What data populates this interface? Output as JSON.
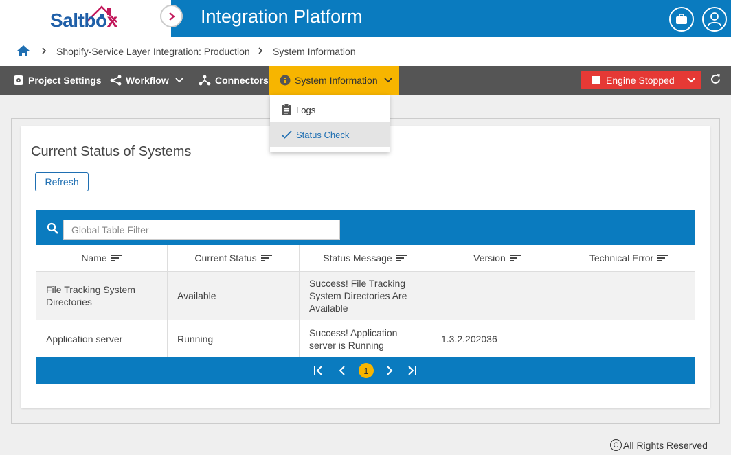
{
  "header": {
    "logo_text_main": "Saltbo",
    "logo_text_x": "x",
    "title": "Integration Platform"
  },
  "breadcrumb": {
    "project": "Shopify-Service Layer Integration: Production",
    "current": "System Information"
  },
  "toolbar": {
    "project_settings": "Project Settings",
    "workflow": "Workflow",
    "connectors": "Connectors",
    "system_information": "System Information",
    "engine_status": "Engine Stopped"
  },
  "dropdown": {
    "items": [
      {
        "label": "Logs",
        "icon": "clipboard-icon"
      },
      {
        "label": "Status Check",
        "icon": "check-icon",
        "selected": true
      }
    ]
  },
  "main": {
    "title": "Current Status of Systems",
    "refresh_label": "Refresh",
    "filter_placeholder": "Global Table Filter",
    "columns": [
      "Name",
      "Current Status",
      "Status Message",
      "Version",
      "Technical Error"
    ],
    "rows": [
      {
        "name": "File Tracking System Directories",
        "status": "Available",
        "message": "Success! File Tracking System Directories Are Available",
        "version": "",
        "error": ""
      },
      {
        "name": "Application server",
        "status": "Running",
        "message": "Success! Application server is Running",
        "version": "1.3.2.202036",
        "error": ""
      }
    ],
    "current_page": "1"
  },
  "footer": {
    "copyright_symbol": "C",
    "text": "All Rights Reserved"
  },
  "colors": {
    "primary": "#0a7bbf",
    "accent": "#f7b500",
    "toolbar": "#555555",
    "danger": "#e53935"
  }
}
